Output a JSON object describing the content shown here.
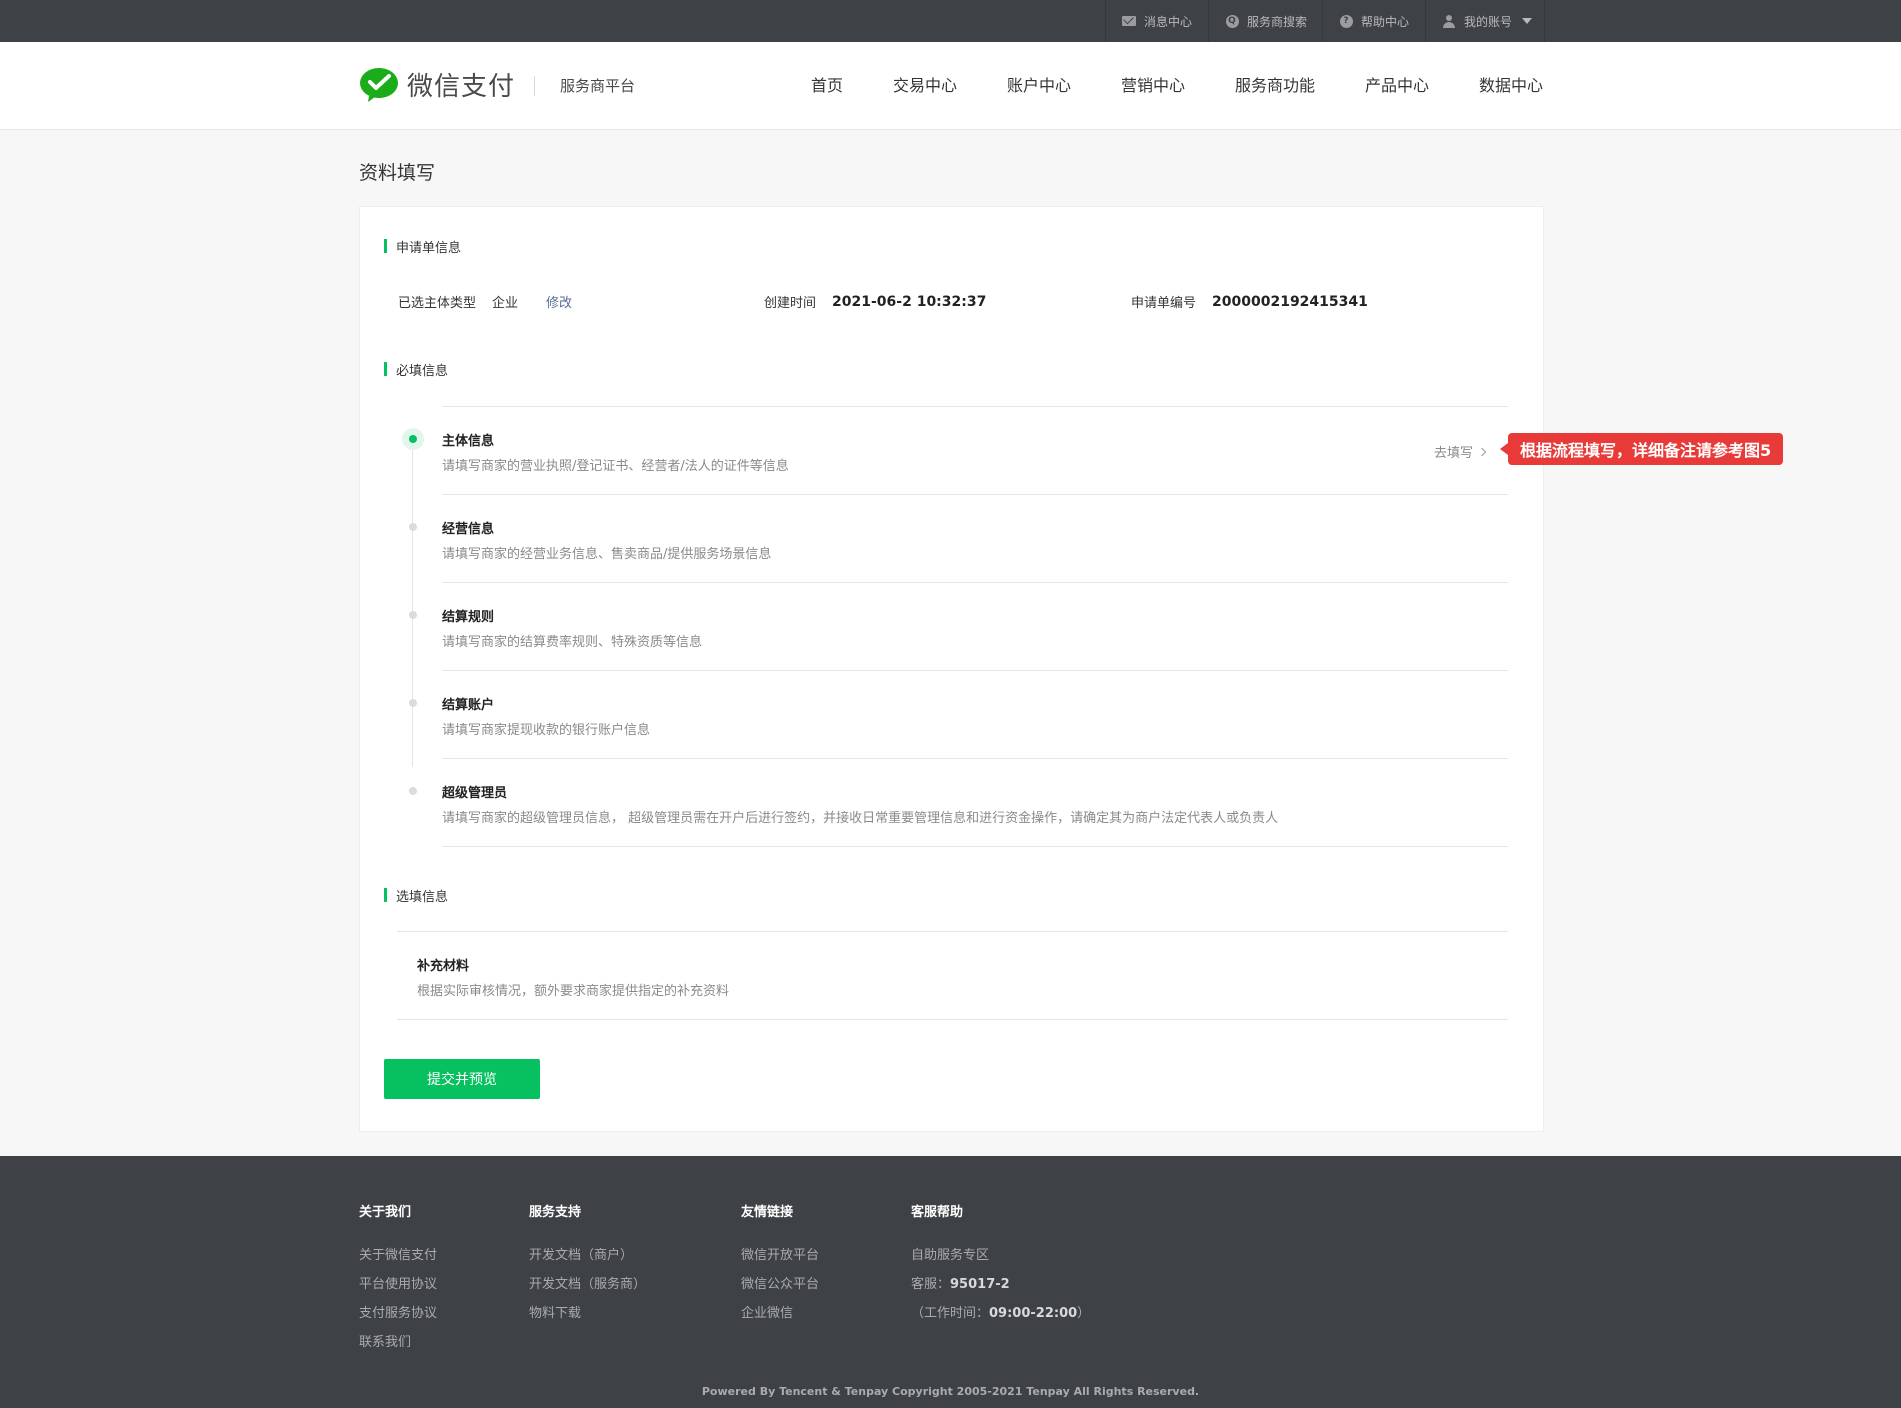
{
  "topbar": {
    "items": [
      {
        "icon": "mail-icon",
        "label": "消息中心"
      },
      {
        "icon": "search-icon",
        "label": "服务商搜索"
      },
      {
        "icon": "help-icon",
        "label": "帮助中心"
      },
      {
        "icon": "user-icon",
        "label": "我的账号"
      }
    ]
  },
  "header": {
    "logo_text": "微信支付",
    "platform": "服务商平台",
    "nav": [
      "首页",
      "交易中心",
      "账户中心",
      "营销中心",
      "服务商功能",
      "产品中心",
      "数据中心"
    ]
  },
  "page": {
    "title": "资料填写",
    "application": {
      "section_title": "申请单信息",
      "subject_type_label": "已选主体类型",
      "subject_type_value": "企业",
      "modify_label": "修改",
      "created_label": "创建时间",
      "created_value": "2021-06-2 10:32:37",
      "app_no_label": "申请单编号",
      "app_no_value": "2000002192415341"
    },
    "required": {
      "section_title": "必填信息",
      "go_fill_label": "去填写",
      "steps": [
        {
          "title": "主体信息",
          "desc": "请填写商家的营业执照/登记证书、经营者/法人的证件等信息"
        },
        {
          "title": "经营信息",
          "desc": "请填写商家的经营业务信息、售卖商品/提供服务场景信息"
        },
        {
          "title": "结算规则",
          "desc": "请填写商家的结算费率规则、特殊资质等信息"
        },
        {
          "title": "结算账户",
          "desc": "请填写商家提现收款的银行账户信息"
        },
        {
          "title": "超级管理员",
          "desc": "请填写商家的超级管理员信息， 超级管理员需在开户后进行签约，并接收日常重要管理信息和进行资金操作，请确定其为商户法定代表人或负责人"
        }
      ]
    },
    "optional": {
      "section_title": "选填信息",
      "item_title": "补充材料",
      "item_desc": "根据实际审核情况，额外要求商家提供指定的补充资料"
    },
    "submit_label": "提交并预览",
    "annotation": "根据流程填写，详细备注请参考图5"
  },
  "footer": {
    "columns": [
      {
        "title": "关于我们",
        "links": [
          "关于微信支付",
          "平台使用协议",
          "支付服务协议",
          "联系我们"
        ]
      },
      {
        "title": "服务支持",
        "links": [
          "开发文档（商户）",
          "开发文档（服务商）",
          "物料下载"
        ]
      },
      {
        "title": "友情链接",
        "links": [
          "微信开放平台",
          "微信公众平台",
          "企业微信"
        ]
      },
      {
        "title": "客服帮助",
        "links": [
          "自助服务专区"
        ]
      }
    ],
    "hotline_label": "客服：",
    "hotline_value": "95017-2",
    "hours_label": "（工作时间：",
    "hours_value": "09:00-22:00",
    "hours_close": "）",
    "copyright": "Powered By Tencent & Tenpay   Copyright 2005-2021 Tenpay All Rights Reserved."
  }
}
